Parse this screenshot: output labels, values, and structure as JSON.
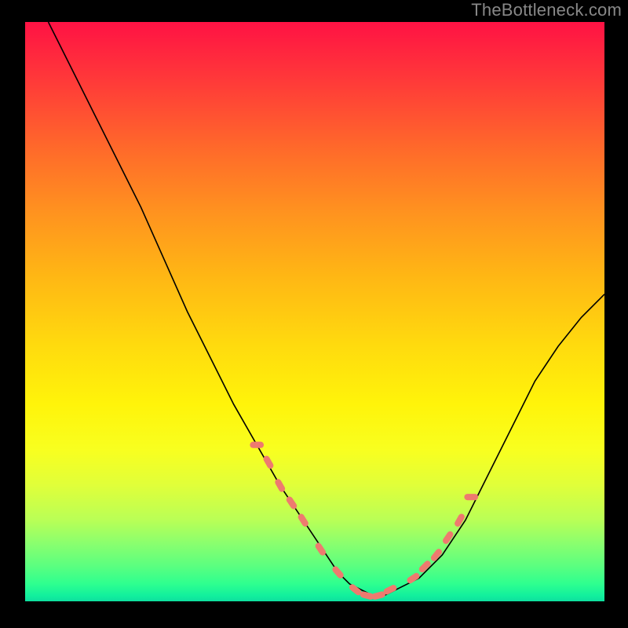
{
  "watermark": "TheBottleneck.com",
  "colors": {
    "background": "#000000",
    "curve_stroke": "#000000",
    "marker_fill": "#ee7a6f",
    "marker_stroke": "#ee7a6f"
  },
  "chart_data": {
    "type": "line",
    "title": "",
    "xlabel": "",
    "ylabel": "",
    "xlim": [
      0,
      100
    ],
    "ylim": [
      0,
      100
    ],
    "grid": false,
    "legend": null,
    "series": [
      {
        "name": "bottleneck-curve",
        "x": [
          4,
          8,
          12,
          16,
          20,
          24,
          28,
          32,
          36,
          40,
          44,
          48,
          52,
          54,
          56,
          58,
          60,
          62,
          64,
          68,
          72,
          76,
          80,
          84,
          88,
          92,
          96,
          100
        ],
        "values": [
          100,
          92,
          84,
          76,
          68,
          59,
          50,
          42,
          34,
          27,
          20,
          14,
          8,
          5,
          3,
          2,
          1,
          1,
          2,
          4,
          8,
          14,
          22,
          30,
          38,
          44,
          49,
          53
        ]
      }
    ],
    "markers": {
      "name": "highlight-segment",
      "x": [
        40,
        42,
        44,
        46,
        48,
        51,
        54,
        57,
        59,
        61,
        63,
        67,
        69,
        71,
        73,
        75,
        77
      ],
      "values": [
        27,
        24,
        20,
        17,
        14,
        9,
        5,
        2,
        1,
        1,
        2,
        4,
        6,
        8,
        11,
        14,
        18
      ]
    }
  }
}
